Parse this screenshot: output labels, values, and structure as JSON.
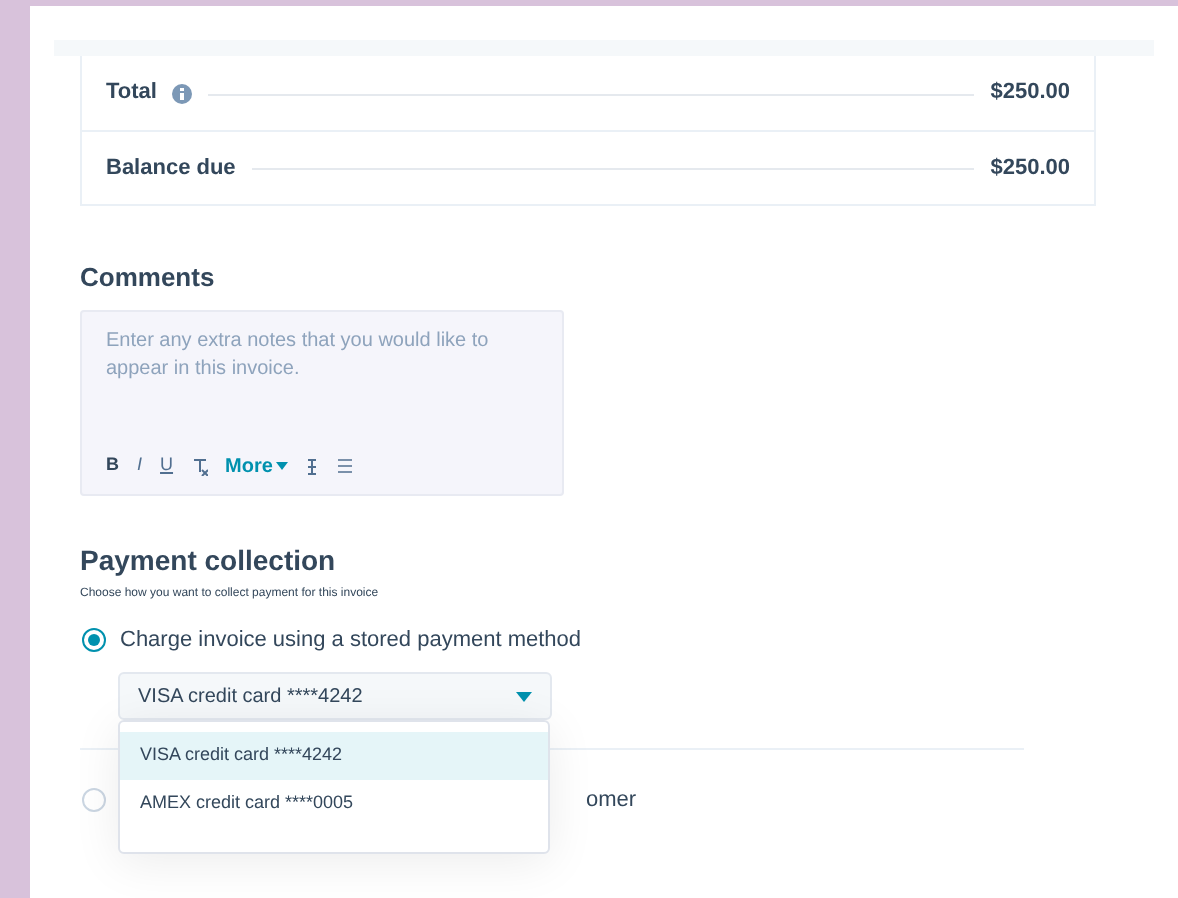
{
  "summary": [
    {
      "label": "Total",
      "info": true,
      "value": "$250.00"
    },
    {
      "label": "Balance due",
      "info": false,
      "value": "$250.00"
    }
  ],
  "comments": {
    "title": "Comments",
    "placeholder": "Enter any extra notes that you would like to appear in this invoice.",
    "toolbar": [
      {
        "kind": "bold",
        "label": "B"
      },
      {
        "kind": "italic",
        "label": "I"
      },
      {
        "kind": "underline",
        "label": "U"
      },
      {
        "kind": "clear"
      },
      {
        "kind": "more",
        "label": "More"
      },
      {
        "kind": "insert"
      },
      {
        "kind": "list"
      }
    ]
  },
  "payment": {
    "title": "Payment collection",
    "subtitle": "Choose how you want to collect payment for this invoice",
    "options": [
      {
        "label": "Charge invoice using a stored payment method",
        "selected": true
      },
      {
        "label": "omer",
        "selected": false
      }
    ],
    "select": {
      "value": "VISA credit card ****4242",
      "expanded": true,
      "menu": [
        {
          "label": "VISA credit card ****4242",
          "selected": true
        },
        {
          "label": "AMEX credit card ****0005",
          "selected": false
        }
      ]
    }
  }
}
